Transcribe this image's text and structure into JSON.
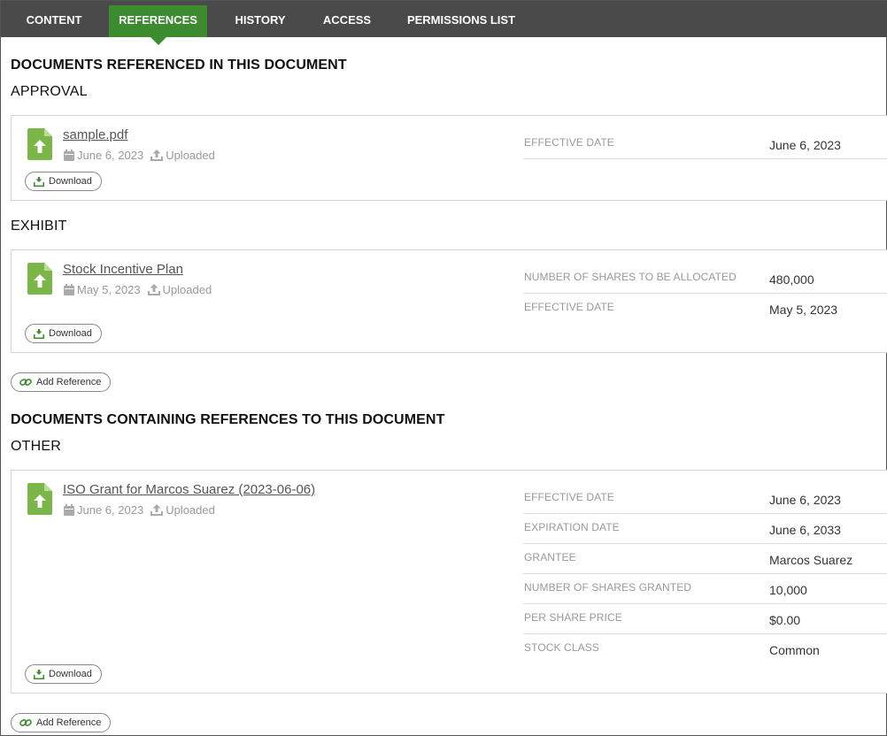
{
  "tabs": [
    {
      "label": "CONTENT",
      "active": false
    },
    {
      "label": "REFERENCES",
      "active": true
    },
    {
      "label": "HISTORY",
      "active": false
    },
    {
      "label": "ACCESS",
      "active": false
    },
    {
      "label": "PERMISSIONS LIST",
      "active": false
    }
  ],
  "colors": {
    "tab_bar": "#4a4a4a",
    "active_tab": "#3d8b2f",
    "file_icon": "#7ab648"
  },
  "referenced": {
    "title": "DOCUMENTS REFERENCED IN THIS DOCUMENT",
    "groups": [
      {
        "name": "APPROVAL",
        "doc": {
          "title": "sample.pdf",
          "date": "June 6, 2023",
          "status": "Uploaded",
          "download": "Download",
          "fields": [
            {
              "label": "EFFECTIVE DATE",
              "value": "June 6, 2023"
            }
          ]
        }
      },
      {
        "name": "EXHIBIT",
        "doc": {
          "title": "Stock Incentive Plan",
          "date": "May 5, 2023",
          "status": "Uploaded",
          "download": "Download",
          "fields": [
            {
              "label": "NUMBER OF SHARES TO BE ALLOCATED",
              "value": "480,000"
            },
            {
              "label": "EFFECTIVE DATE",
              "value": "May 5, 2023"
            }
          ]
        }
      }
    ],
    "add_reference": "Add Reference"
  },
  "containing": {
    "title": "DOCUMENTS CONTAINING REFERENCES TO THIS DOCUMENT",
    "groups": [
      {
        "name": "OTHER",
        "doc": {
          "title": "ISO Grant for Marcos Suarez (2023-06-06)",
          "date": "June 6, 2023",
          "status": "Uploaded",
          "download": "Download",
          "fields": [
            {
              "label": "EFFECTIVE DATE",
              "value": "June 6, 2023"
            },
            {
              "label": "EXPIRATION DATE",
              "value": "June 6, 2033"
            },
            {
              "label": "GRANTEE",
              "value": "Marcos Suarez"
            },
            {
              "label": "NUMBER OF SHARES GRANTED",
              "value": "10,000"
            },
            {
              "label": "PER SHARE PRICE",
              "value": "$0.00"
            },
            {
              "label": "STOCK CLASS",
              "value": "Common"
            }
          ]
        }
      }
    ],
    "add_reference": "Add Reference"
  }
}
